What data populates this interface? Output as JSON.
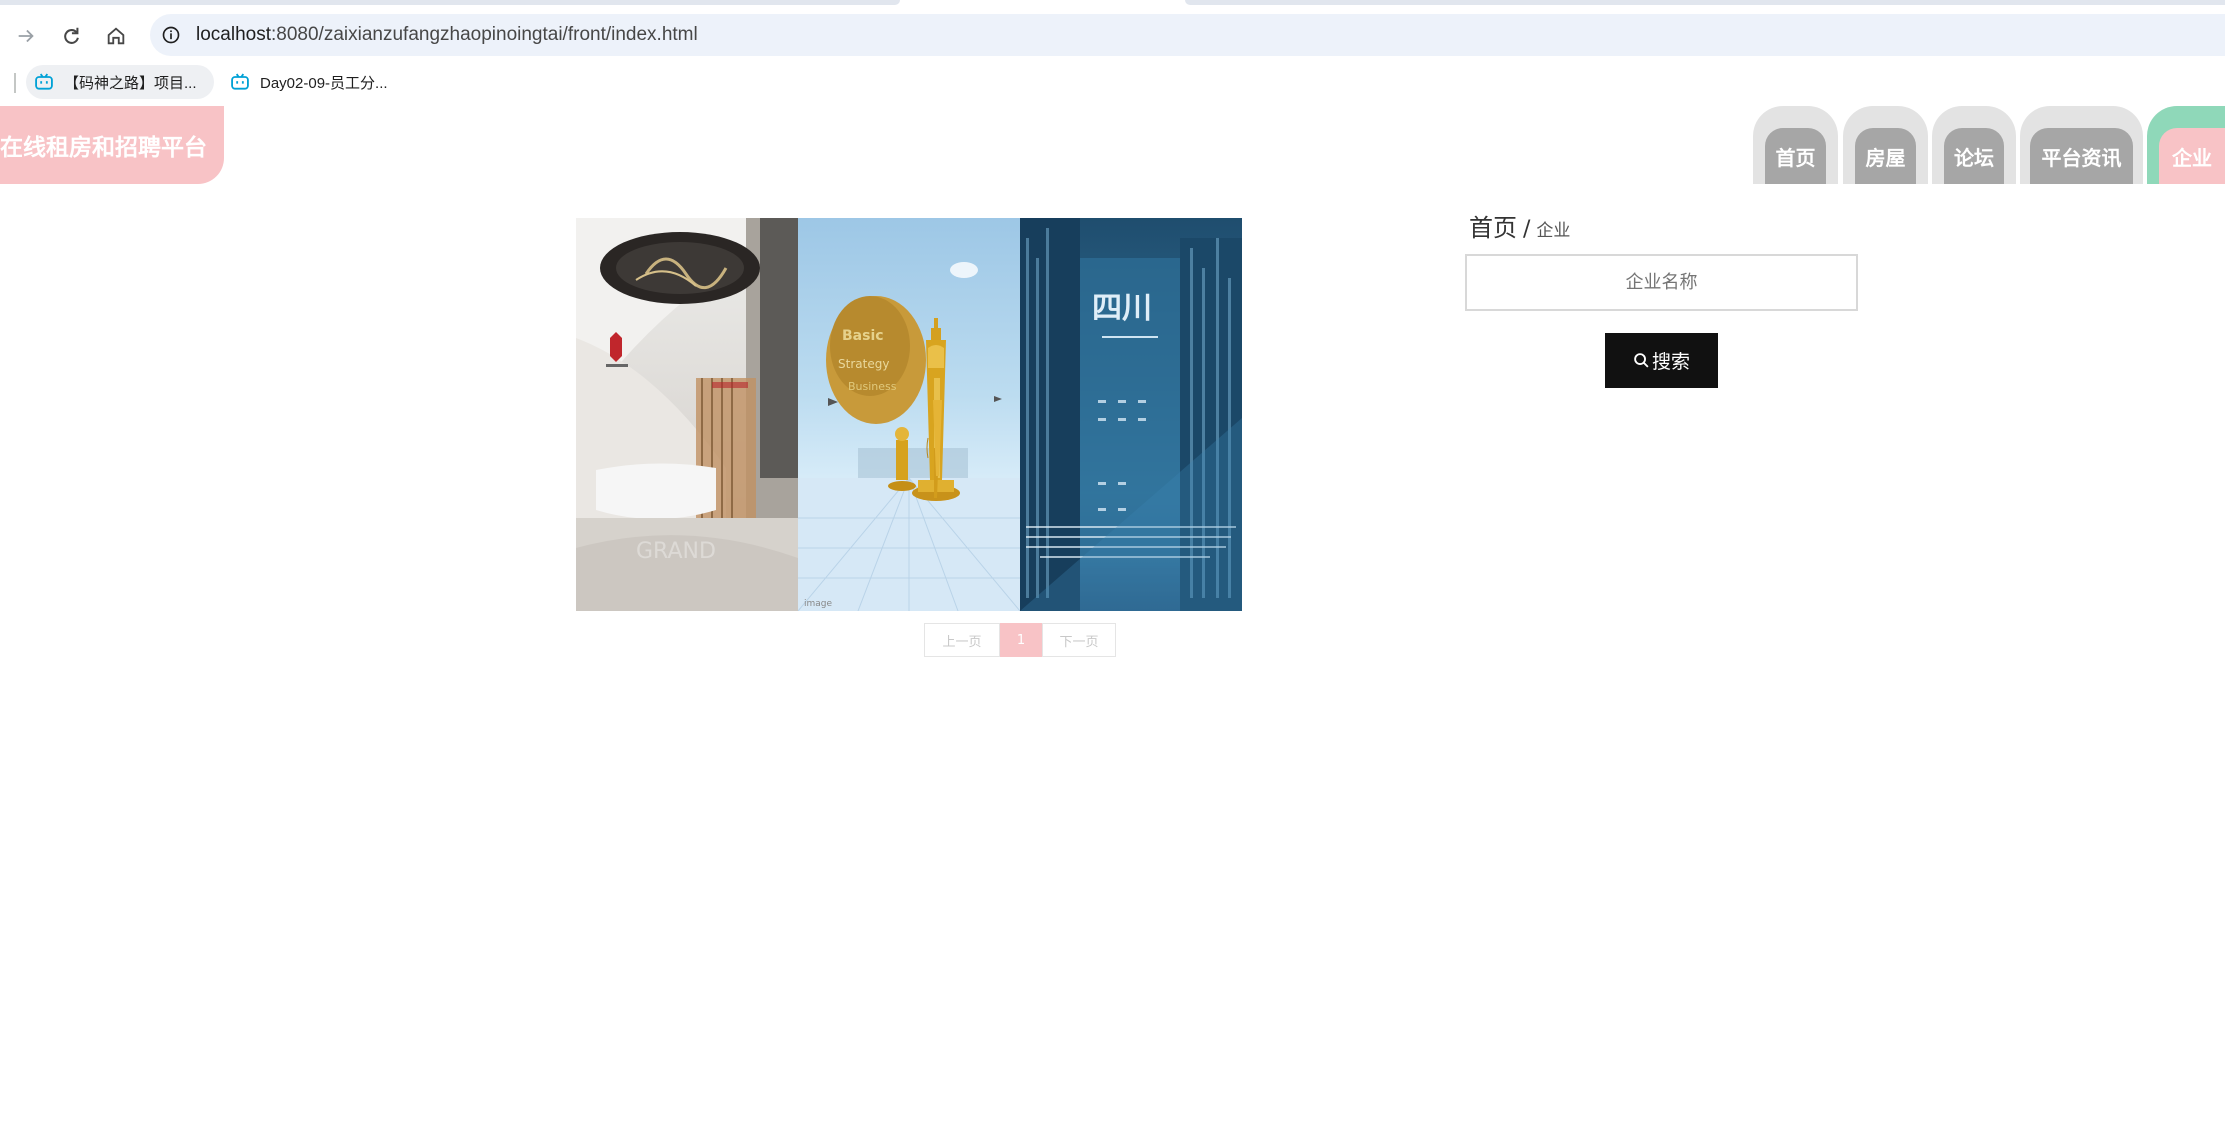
{
  "browser": {
    "url_host": "localhost",
    "url_path": ":8080/zaixianzufangzhaopinoingtai/front/index.html",
    "bookmarks": [
      {
        "label": "【码神之路】项目...",
        "icon": "bilibili-icon"
      },
      {
        "label": "Day02-09-员工分...",
        "icon": "bilibili-icon"
      }
    ]
  },
  "header": {
    "site_title": "在线租房和招聘平台",
    "menu": [
      {
        "label": "首页",
        "active": false
      },
      {
        "label": "房屋",
        "active": false
      },
      {
        "label": "论坛",
        "active": false
      },
      {
        "label": "平台资讯",
        "active": false
      },
      {
        "label": "企业",
        "active": true
      }
    ]
  },
  "breadcrumb": {
    "home": "首页",
    "separator": "/",
    "current": "企业"
  },
  "search": {
    "placeholder": "企业名称",
    "button_label": "搜索"
  },
  "pager": {
    "prev": "上一页",
    "current": "1",
    "next": "下一页"
  },
  "colors": {
    "accent_pink": "#f8c3c6",
    "accent_green": "#8fd8b9",
    "menu_gray": "#a6a6a6"
  }
}
